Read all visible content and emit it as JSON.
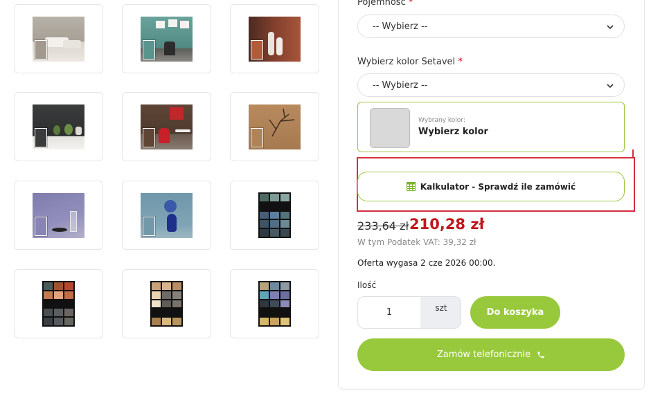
{
  "options": {
    "capacity_label": "Pojemność",
    "capacity_required": "*",
    "capacity_select": "-- Wybierz --",
    "color_label": "Wybierz kolor Setavel",
    "color_required": "*",
    "color_select": "-- Wybierz --"
  },
  "selected_color": {
    "small_label": "Wybrany kolor:",
    "value": "Wybierz kolor",
    "swatch_color": "#d9d9d9"
  },
  "calculator": {
    "label": "Kalkulator - Sprawdź ile zamówić",
    "icon": "calculator-icon"
  },
  "price": {
    "old": "233,64 zł",
    "new": "210,28 zł",
    "vat": "W tym Podatek VAT: 39,32 zł",
    "offer": "Oferta wygasa 2 cze 2026 00:00."
  },
  "quantity": {
    "label": "Ilość",
    "value": "1",
    "unit": "szt"
  },
  "buttons": {
    "add_to_cart": "Do koszyka",
    "order_by_phone": "Zamów telefonicznie",
    "phone_icon": "phone-icon"
  },
  "colors": {
    "accent_green": "#98c93c",
    "price_red": "#c0161d",
    "highlight_frame": "#d32f3f"
  },
  "thumbnails": [
    {
      "name": "beige-wall-sofa"
    },
    {
      "name": "teal-wall-chair"
    },
    {
      "name": "red-brown-wall-vases"
    },
    {
      "name": "dark-grey-wall-plants"
    },
    {
      "name": "brown-wall-red-chair"
    },
    {
      "name": "tan-wall-branch"
    },
    {
      "name": "lilac-wall-glass"
    },
    {
      "name": "blue-wall-vase"
    },
    {
      "name": "swatch-grid-cool"
    },
    {
      "name": "swatch-grid-warm"
    },
    {
      "name": "swatch-grid-sand"
    },
    {
      "name": "swatch-grid-mixed"
    }
  ]
}
